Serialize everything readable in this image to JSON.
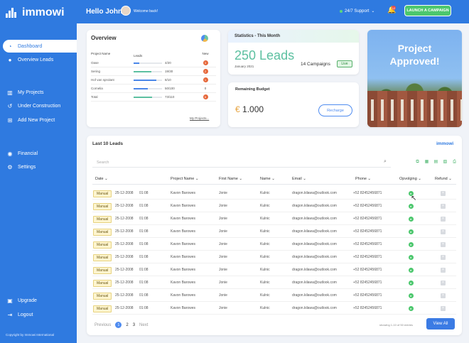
{
  "brand": {
    "logo_text": "immowi",
    "copyright": "Copyright by Immowi International"
  },
  "sidebar": {
    "items": [
      {
        "label": "Dashboard",
        "icon": "dashboard-icon",
        "active": true
      },
      {
        "label": "Overview Leads",
        "icon": "user-icon"
      },
      {
        "label": "My Projects",
        "icon": "building-icon"
      },
      {
        "label": "Under Construction",
        "icon": "history-icon"
      },
      {
        "label": "Add New Project",
        "icon": "add-icon"
      },
      {
        "label": "Financial",
        "icon": "money-icon"
      },
      {
        "label": "Settings",
        "icon": "settings-icon"
      },
      {
        "label": "Upgrade",
        "icon": "upgrade-icon"
      },
      {
        "label": "Logout",
        "icon": "logout-icon"
      }
    ]
  },
  "topbar": {
    "greeting": "Hello John",
    "welcome": "Welcome back!",
    "support": "24/7 Support",
    "notification_count": "12",
    "launch_label": "LAUNCH A CAMPAIGN"
  },
  "overview": {
    "title": "Overview",
    "headers": [
      "Project Name",
      "Leads",
      "New"
    ],
    "rows": [
      {
        "name": "Oase",
        "leads": "4/20",
        "progress": 0.2,
        "new": "3",
        "new_badge": true
      },
      {
        "name": "Sering",
        "leads": "19/30",
        "progress": 0.63,
        "new": "2",
        "new_badge": true
      },
      {
        "name": "Hof van sprolant",
        "leads": "8/10",
        "progress": 0.8,
        "new": "1",
        "new_badge": true
      },
      {
        "name": "Cornelia",
        "leads": "50/100",
        "progress": 0.5,
        "new": "0",
        "new_badge": false
      },
      {
        "name": "Total",
        "leads": "73/110",
        "progress": 0.66,
        "new": "6",
        "new_badge": true
      }
    ],
    "my_projects": "My Projects..."
  },
  "stats": {
    "title": "Statistics - This Month",
    "leads": "250 Leads",
    "period": "January 2021",
    "campaigns": "14 Campaigns",
    "live": "Live"
  },
  "budget": {
    "title": "Remaining Budget",
    "currency": "€",
    "amount": "1.000",
    "recharge": "Recharge"
  },
  "promo": {
    "line1": "Project",
    "line2": "Approved!"
  },
  "leads_table": {
    "title": "Last 10 Leads",
    "logo": "immowi",
    "search_placeholder": "Search",
    "headers": [
      "Date",
      "Project Name",
      "First Name",
      "Name",
      "Email",
      "Phone",
      "Opvolging",
      "Refund"
    ],
    "rows": [
      {
        "type": "Manual",
        "date": "25-12-2008",
        "time": "01:08",
        "project": "Kavon Barowes",
        "first": "Jonie",
        "name": "Kulnic",
        "email": "dragon.kilawa@outlook.com",
        "phone": "+52 82452456871"
      },
      {
        "type": "Manual",
        "date": "25-12-2008",
        "time": "01:08",
        "project": "Kavon Barowes",
        "first": "Jonie",
        "name": "Kulnic",
        "email": "dragon.kilawa@outlook.com",
        "phone": "+52 82452456871"
      },
      {
        "type": "Manual",
        "date": "25-12-2008",
        "time": "01:08",
        "project": "Kavon Barowes",
        "first": "Jonie",
        "name": "Kulnic",
        "email": "dragon.kilawa@outlook.com",
        "phone": "+52 82452456871"
      },
      {
        "type": "Manual",
        "date": "25-12-2008",
        "time": "01:08",
        "project": "Kavon Barowes",
        "first": "Jonie",
        "name": "Kulnic",
        "email": "dragon.kilawa@outlook.com",
        "phone": "+52 82452456871"
      },
      {
        "type": "Manual",
        "date": "25-12-2008",
        "time": "01:08",
        "project": "Kavon Barowes",
        "first": "Jonie",
        "name": "Kulnic",
        "email": "dragon.kilawa@outlook.com",
        "phone": "+52 82452456871"
      },
      {
        "type": "Manual",
        "date": "25-12-2008",
        "time": "01:08",
        "project": "Kavon Barowes",
        "first": "Jonie",
        "name": "Kulnic",
        "email": "dragon.kilawa@outlook.com",
        "phone": "+52 82452456871"
      },
      {
        "type": "Manual",
        "date": "25-12-2008",
        "time": "01:08",
        "project": "Kavon Barowes",
        "first": "Jonie",
        "name": "Kulnic",
        "email": "dragon.kilawa@outlook.com",
        "phone": "+52 82452456871"
      },
      {
        "type": "Manual",
        "date": "25-12-2008",
        "time": "01:08",
        "project": "Kavon Barowes",
        "first": "Jonie",
        "name": "Kulnic",
        "email": "dragon.kilawa@outlook.com",
        "phone": "+52 82452456871"
      },
      {
        "type": "Manual",
        "date": "25-12-2008",
        "time": "01:08",
        "project": "Kavon Barowes",
        "first": "Jonie",
        "name": "Kulnic",
        "email": "dragon.kilawa@outlook.com",
        "phone": "+52 82452456871"
      },
      {
        "type": "Manual",
        "date": "25-12-2008",
        "time": "01:08",
        "project": "Kavon Barowes",
        "first": "Jonie",
        "name": "Kulnic",
        "email": "dragon.kilawa@outlook.com",
        "phone": "+52 82452456871"
      }
    ],
    "pagination": {
      "previous": "Previous",
      "pages": [
        "1",
        "2",
        "3"
      ],
      "next": "Next"
    },
    "showing": "showing 1-10 of 50 entries",
    "view_all": "View All"
  }
}
